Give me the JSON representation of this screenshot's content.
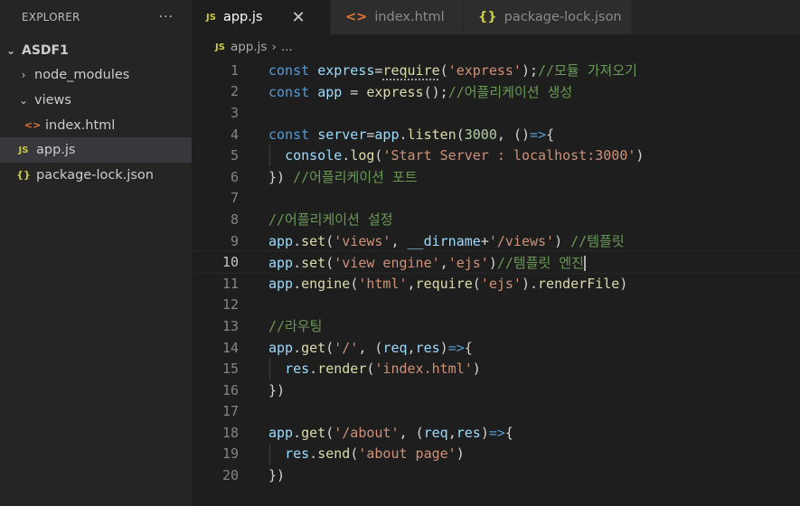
{
  "explorer": {
    "title": "EXPLORER",
    "more": "···",
    "root": "ASDF1",
    "items": [
      {
        "label": "node_modules"
      },
      {
        "label": "views"
      },
      {
        "label": "index.html"
      },
      {
        "label": "app.js"
      },
      {
        "label": "package-lock.json"
      }
    ]
  },
  "tabs": [
    {
      "label": "app.js",
      "icon": "JS",
      "active": true
    },
    {
      "label": "index.html",
      "icon": "<>"
    },
    {
      "label": "package-lock.json",
      "icon": "{}"
    }
  ],
  "tab_close": "✕",
  "breadcrumb": {
    "file": "app.js",
    "tail": "..."
  },
  "icons": {
    "js": "JS",
    "html": "<>",
    "json": "{}",
    "chev_right": "›",
    "chev_down": "⌄"
  },
  "colors": {
    "keyword": "#569cd6",
    "variable": "#9cdcfe",
    "function": "#dcdcaa",
    "string": "#ce9178",
    "comment": "#6a9955",
    "number": "#b5cea8"
  },
  "code": [
    {
      "n": "1",
      "t": [
        [
          "k",
          "const "
        ],
        [
          "v",
          "express"
        ],
        [
          "p",
          "="
        ],
        [
          "f",
          "require"
        ],
        [
          "p",
          "("
        ],
        [
          "s",
          "'express'"
        ],
        [
          "p",
          ");"
        ],
        [
          "c",
          "//모듈 가져오기"
        ]
      ]
    },
    {
      "n": "2",
      "t": [
        [
          "k",
          "const "
        ],
        [
          "v",
          "app"
        ],
        [
          "p",
          " = "
        ],
        [
          "f",
          "express"
        ],
        [
          "p",
          "();"
        ],
        [
          "c",
          "//어플리케이션 생성"
        ]
      ]
    },
    {
      "n": "3",
      "t": []
    },
    {
      "n": "4",
      "t": [
        [
          "k",
          "const "
        ],
        [
          "v",
          "server"
        ],
        [
          "p",
          "="
        ],
        [
          "v",
          "app"
        ],
        [
          "p",
          "."
        ],
        [
          "f",
          "listen"
        ],
        [
          "p",
          "("
        ],
        [
          "n",
          "3000"
        ],
        [
          "p",
          ", "
        ],
        [
          "p",
          "()"
        ],
        [
          "k",
          "=>"
        ],
        [
          "p",
          "{"
        ]
      ]
    },
    {
      "n": "5",
      "t": [
        [
          "v",
          "console"
        ],
        [
          "p",
          "."
        ],
        [
          "f",
          "log"
        ],
        [
          "p",
          "("
        ],
        [
          "s",
          "'Start Server : localhost:3000'"
        ],
        [
          "p",
          ")"
        ]
      ]
    },
    {
      "n": "6",
      "t": [
        [
          "p",
          "}) "
        ],
        [
          "c",
          "//어플리케이션 포트"
        ]
      ]
    },
    {
      "n": "7",
      "t": []
    },
    {
      "n": "8",
      "t": [
        [
          "c",
          "//어플리케이션 설정"
        ]
      ]
    },
    {
      "n": "9",
      "t": [
        [
          "v",
          "app"
        ],
        [
          "p",
          "."
        ],
        [
          "f",
          "set"
        ],
        [
          "p",
          "("
        ],
        [
          "s",
          "'views'"
        ],
        [
          "p",
          ", "
        ],
        [
          "v",
          "__dirname"
        ],
        [
          "p",
          "+"
        ],
        [
          "s",
          "'/views'"
        ],
        [
          "p",
          ") "
        ],
        [
          "c",
          "//템플릿"
        ]
      ]
    },
    {
      "n": "10",
      "t": [
        [
          "v",
          "app"
        ],
        [
          "p",
          "."
        ],
        [
          "f",
          "set"
        ],
        [
          "p",
          "("
        ],
        [
          "s",
          "'view engine'"
        ],
        [
          "p",
          ","
        ],
        [
          "s",
          "'ejs'"
        ],
        [
          "p",
          ")"
        ],
        [
          "c",
          "//템플릿 엔진"
        ]
      ]
    },
    {
      "n": "11",
      "t": [
        [
          "v",
          "app"
        ],
        [
          "p",
          "."
        ],
        [
          "f",
          "engine"
        ],
        [
          "p",
          "("
        ],
        [
          "s",
          "'html'"
        ],
        [
          "p",
          ","
        ],
        [
          "f",
          "require"
        ],
        [
          "p",
          "("
        ],
        [
          "s",
          "'ejs'"
        ],
        [
          "p",
          ")."
        ],
        [
          "f",
          "renderFile"
        ],
        [
          "p",
          ")"
        ]
      ]
    },
    {
      "n": "12",
      "t": []
    },
    {
      "n": "13",
      "t": [
        [
          "c",
          "//라우팅"
        ]
      ]
    },
    {
      "n": "14",
      "t": [
        [
          "v",
          "app"
        ],
        [
          "p",
          "."
        ],
        [
          "f",
          "get"
        ],
        [
          "p",
          "("
        ],
        [
          "s",
          "'/'"
        ],
        [
          "p",
          ", "
        ],
        [
          "p",
          "("
        ],
        [
          "v",
          "req"
        ],
        [
          "p",
          ","
        ],
        [
          "v",
          "res"
        ],
        [
          "p",
          ")"
        ],
        [
          "k",
          "=>"
        ],
        [
          "p",
          "{"
        ]
      ]
    },
    {
      "n": "15",
      "t": [
        [
          "v",
          "res"
        ],
        [
          "p",
          "."
        ],
        [
          "f",
          "render"
        ],
        [
          "p",
          "("
        ],
        [
          "s",
          "'index.html'"
        ],
        [
          "p",
          ")"
        ]
      ]
    },
    {
      "n": "16",
      "t": [
        [
          "p",
          "})"
        ]
      ]
    },
    {
      "n": "17",
      "t": []
    },
    {
      "n": "18",
      "t": [
        [
          "v",
          "app"
        ],
        [
          "p",
          "."
        ],
        [
          "f",
          "get"
        ],
        [
          "p",
          "("
        ],
        [
          "s",
          "'/about'"
        ],
        [
          "p",
          ", "
        ],
        [
          "p",
          "("
        ],
        [
          "v",
          "req"
        ],
        [
          "p",
          ","
        ],
        [
          "v",
          "res"
        ],
        [
          "p",
          ")"
        ],
        [
          "k",
          "=>"
        ],
        [
          "p",
          "{"
        ]
      ]
    },
    {
      "n": "19",
      "t": [
        [
          "v",
          "res"
        ],
        [
          "p",
          "."
        ],
        [
          "f",
          "send"
        ],
        [
          "p",
          "("
        ],
        [
          "s",
          "'about page'"
        ],
        [
          "p",
          ")"
        ]
      ]
    },
    {
      "n": "20",
      "t": [
        [
          "p",
          "})"
        ]
      ]
    }
  ]
}
